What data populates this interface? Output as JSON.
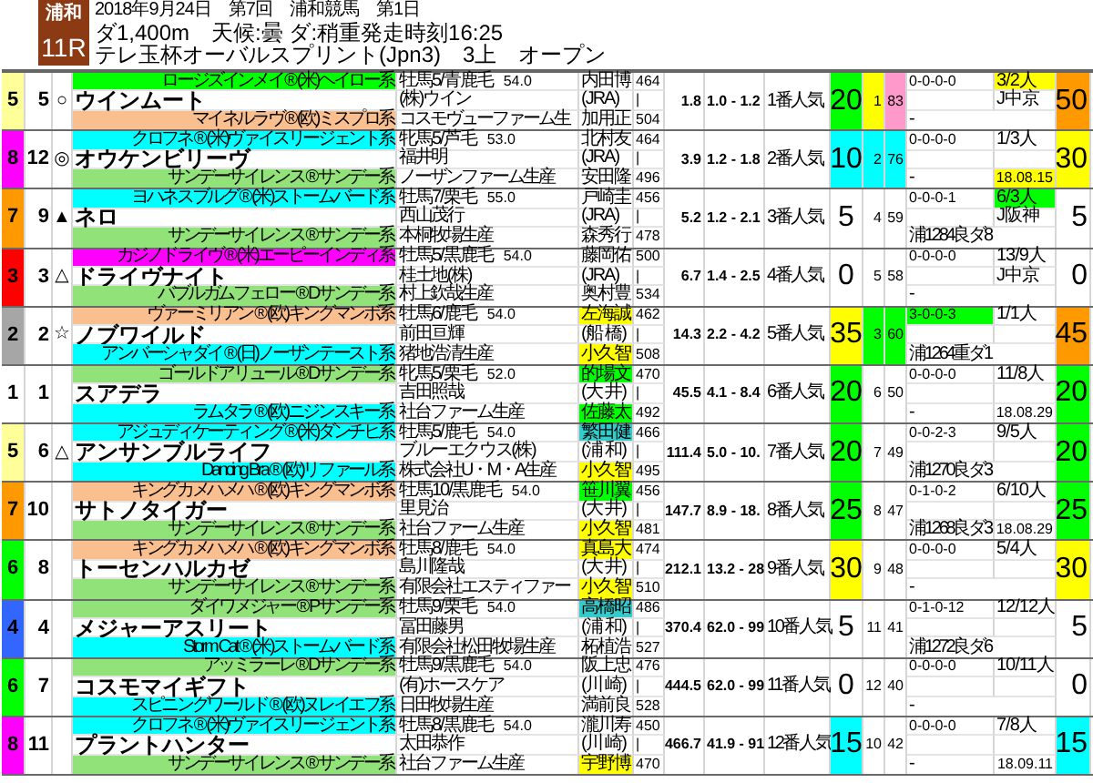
{
  "header": {
    "venue": "浦和",
    "race_no": "11R",
    "date_line": "2018年9月24日　第7回　浦和競馬　第1日",
    "course_line": "ダ1,400m　天候:曇 ダ:稍重発走時刻16:25",
    "race_title": "テレ玉杯オーバルスプリント(Jpn3)　3上　オープン"
  },
  "horses": [
    {
      "waku": {
        "text": "5",
        "color": "#ffff99"
      },
      "num": "5",
      "mark": "○",
      "sire_line": {
        "text": "ロージズインメイ ® (米)ヘイロー系",
        "color": "#00ff00"
      },
      "name": "ウインムート",
      "dam_line": {
        "text": "マイネルラヴ ® (欧)ミスプロ系",
        "color": "#fabf8f"
      },
      "sex_coat": "牡馬5/青鹿毛",
      "load": "54.0",
      "owner": "(株)ウイン",
      "breeder": "コスモヴューファーム生",
      "jockey": {
        "text": "内田博"
      },
      "affiliation": "(JRA)",
      "trainer": {
        "text": "加用正"
      },
      "body_weight": "464",
      "body_mid": "|",
      "body_weight_2": "504",
      "odds": "1.8",
      "odds_range": "1.0 - 1.2",
      "popularity": "1番人気",
      "score": {
        "text": "20",
        "color": "#00ff00"
      },
      "rank": {
        "text": "1",
        "color": "#ffff00"
      },
      "index": {
        "text": "83",
        "color": "#ff99cc"
      },
      "record": {
        "text": "0-0-0-0"
      },
      "record_note": "-",
      "past_rank": {
        "text": "3/2人",
        "color": "#ffff00"
      },
      "past_course": "J中京",
      "final": {
        "text": "50",
        "color": "#ff9900"
      }
    },
    {
      "waku": {
        "text": "8",
        "color": "#ff00ff"
      },
      "num": "12",
      "mark": "◎",
      "sire_line": {
        "text": "クロフネ ® (米)ヴァイスリージェント系",
        "color": "#00ffff"
      },
      "name": "オウケンビリーヴ",
      "dam_line": {
        "text": "サンデーサイレンス ® サンデー系",
        "color": "#92e27a"
      },
      "sex_coat": "牝馬5/芦毛",
      "load": "53.0",
      "owner": "福井明",
      "breeder": "ノーザンファーム生産",
      "jockey": {
        "text": "北村友"
      },
      "affiliation": "(JRA)",
      "trainer": {
        "text": "安田隆"
      },
      "body_weight": "464",
      "body_mid": "|",
      "body_weight_2": "496",
      "odds": "3.9",
      "odds_range": "1.2 - 1.8",
      "popularity": "2番人気",
      "score": {
        "text": "10",
        "color": "#00ffff"
      },
      "rank": {
        "text": "2",
        "color": "#00ffff"
      },
      "index": {
        "text": "76",
        "color": "#00ffff"
      },
      "record": {
        "text": "0-0-0-0"
      },
      "record_note": "-",
      "past_rank": {
        "text": "1/3人"
      },
      "past_date": {
        "text": "18.08.15",
        "color": "#ffff00"
      },
      "final": {
        "text": "30",
        "color": "#ffff00"
      }
    },
    {
      "waku": {
        "text": "7",
        "color": "#ff9900"
      },
      "num": "9",
      "mark": "▲",
      "sire_line": {
        "text": "ヨハネスブルグ ® (米)ストームバード系",
        "color": "#00ffff"
      },
      "name": "ネロ",
      "dam_line": {
        "text": "サンデーサイレンス ® サンデー系",
        "color": "#92e27a"
      },
      "sex_coat": "牡馬7/栗毛",
      "load": "55.0",
      "owner": "西山茂行",
      "breeder": "本桐牧場生産",
      "jockey": {
        "text": "戸崎圭"
      },
      "affiliation": "(JRA)",
      "trainer": {
        "text": "森秀行"
      },
      "body_weight": "456",
      "body_mid": "|",
      "body_weight_2": "478",
      "odds": "5.2",
      "odds_range": "1.2 - 2.1",
      "popularity": "3番人気",
      "score": {
        "text": "5"
      },
      "rank": {
        "text": "4"
      },
      "index": {
        "text": "59"
      },
      "record": {
        "text": "0-0-0-1"
      },
      "record_note": "浦1284良ダ8",
      "past_rank": {
        "text": "6/3人",
        "color": "#00ff00"
      },
      "past_course": "J阪神",
      "final": {
        "text": "5"
      }
    },
    {
      "waku": {
        "text": "3",
        "color": "#ff0000"
      },
      "num": "3",
      "mark": "△",
      "sire_line": {
        "text": "カジノドライヴ ® (米)エーピーインディ系",
        "color": "#ff00ff"
      },
      "name": "ドライヴナイト",
      "dam_line": {
        "text": "バブルガムフェロー ® Dサンデー系",
        "color": "#92e27a"
      },
      "sex_coat": "牡馬5/黒鹿毛",
      "load": "54.0",
      "owner": "桂土地(株)",
      "breeder": "村上欽哉生産",
      "jockey": {
        "text": "藤岡佑"
      },
      "affiliation": "(JRA)",
      "trainer": {
        "text": "奥村豊"
      },
      "body_weight": "500",
      "body_mid": "|",
      "body_weight_2": "534",
      "odds": "6.7",
      "odds_range": "1.4 - 2.5",
      "popularity": "4番人気",
      "score": {
        "text": "0"
      },
      "rank": {
        "text": "5"
      },
      "index": {
        "text": "58"
      },
      "record": {
        "text": "0-0-0-0"
      },
      "record_note": "-",
      "past_rank": {
        "text": "13/9人"
      },
      "past_course": "J中京",
      "final": {
        "text": "0"
      }
    },
    {
      "waku": {
        "text": "2",
        "color": "#a6a6a6"
      },
      "num": "2",
      "mark": "☆",
      "sire_line": {
        "text": "ヴァーミリアン ® (欧)キングマンボ系",
        "color": "#fabf8f"
      },
      "name": "ノブワイルド",
      "dam_line": {
        "text": "アンバーシャダイ ® (日)ノーザンテースト系",
        "color": "#00ffff"
      },
      "sex_coat": "牡馬6/鹿毛",
      "load": "54.0",
      "owner": "前田亘輝",
      "breeder": "猪地浩清生産",
      "jockey": {
        "text": "左海誠",
        "color": "#ffff00"
      },
      "affiliation": "(船 橋)",
      "trainer": {
        "text": "小久智",
        "color": "#ffff00"
      },
      "body_weight": "462",
      "body_mid": "|",
      "body_weight_2": "508",
      "odds": "14.3",
      "odds_range": "2.2 - 4.2",
      "popularity": "5番人気",
      "score": {
        "text": "35",
        "color": "#ffff00"
      },
      "rank": {
        "text": "3",
        "color": "#00ff00"
      },
      "index": {
        "text": "60",
        "color": "#00ff00"
      },
      "record": {
        "text": "3-0-0-3",
        "color": "#00ff00"
      },
      "record_note": "浦1264重ダ1",
      "past_rank": {
        "text": "1/1人"
      },
      "final": {
        "text": "45",
        "color": "#ff9900"
      }
    },
    {
      "waku": {
        "text": "1",
        "color": "#ffffff"
      },
      "num": "1",
      "sire_line": {
        "text": "ゴールドアリュール ® Dサンデー系",
        "color": "#92e27a"
      },
      "name": "スアデラ",
      "dam_line": {
        "text": "ラムタラ ® (欧)ニジンスキー系",
        "color": "#00ffff"
      },
      "sex_coat": "牝馬5/栗毛",
      "load": "52.0",
      "owner": "吉田照哉",
      "breeder": "社台ファーム生産",
      "jockey": {
        "text": "的場文",
        "color": "#00ff00"
      },
      "affiliation": "(大 井)",
      "trainer": {
        "text": "佐藤太",
        "color": "#00ff00"
      },
      "body_weight": "470",
      "body_mid": "|",
      "body_weight_2": "492",
      "odds": "45.5",
      "odds_range": "4.1 - 8.4",
      "popularity": "6番人気",
      "score": {
        "text": "20",
        "color": "#00ff00"
      },
      "rank": {
        "text": "6"
      },
      "index": {
        "text": "50"
      },
      "record": {
        "text": "0-0-0-0"
      },
      "record_note": "-",
      "past_rank": {
        "text": "11/8人"
      },
      "past_date": {
        "text": "18.08.29"
      },
      "final": {
        "text": "20",
        "color": "#00ff00"
      }
    },
    {
      "waku": {
        "text": "5",
        "color": "#ffff99"
      },
      "num": "6",
      "mark": "△",
      "sire_line": {
        "text": "アジュディケーティング ® (米)ダンチヒ系",
        "color": "#00ffff"
      },
      "name": "アンサンブルライフ",
      "dam_line": {
        "text": "Dancing Bra ® (欧)リファール系",
        "color": "#00ffff"
      },
      "sex_coat": "牡馬5/鹿毛",
      "load": "54.0",
      "owner": "ブルーエクウス(株)",
      "breeder": "株式会社U・M・A生産",
      "jockey": {
        "text": "繁田健",
        "color": "#33cccc"
      },
      "affiliation": "(浦 和)",
      "trainer": {
        "text": "小久智",
        "color": "#ffff00"
      },
      "body_weight": "466",
      "body_mid": "|",
      "body_weight_2": "495",
      "odds": "111.4",
      "odds_range": "5.0 - 10.",
      "popularity": "7番人気",
      "score": {
        "text": "20",
        "color": "#00ff00"
      },
      "rank": {
        "text": "7"
      },
      "index": {
        "text": "49"
      },
      "record": {
        "text": "0-0-2-3"
      },
      "record_note": "浦1270良ダ3",
      "past_rank": {
        "text": "9/5人"
      },
      "final": {
        "text": "20",
        "color": "#00ff00"
      }
    },
    {
      "waku": {
        "text": "7",
        "color": "#ff9900"
      },
      "num": "10",
      "sire_line": {
        "text": "キングカメハメハ ® (欧)キングマンボ系",
        "color": "#fabf8f"
      },
      "name": "サトノタイガー",
      "dam_line": {
        "text": "サンデーサイレンス ® サンデー系",
        "color": "#92e27a"
      },
      "sex_coat": "牡馬10/黒鹿毛",
      "load": "54.0",
      "owner": "里見治",
      "breeder": "社台ファーム生産",
      "jockey": {
        "text": "笹川翼",
        "color": "#00ff00"
      },
      "affiliation": "(大 井)",
      "trainer": {
        "text": "小久智",
        "color": "#ffff00"
      },
      "body_weight": "456",
      "body_mid": "|",
      "body_weight_2": "481",
      "odds": "147.7",
      "odds_range": "8.9 - 18.",
      "popularity": "8番人気",
      "score": {
        "text": "25",
        "color": "#00ff00"
      },
      "rank": {
        "text": "8"
      },
      "index": {
        "text": "47"
      },
      "record": {
        "text": "0-1-0-2"
      },
      "record_note": "浦1268良ダ3",
      "past_rank": {
        "text": "6/10人"
      },
      "past_date": {
        "text": "18.08.29"
      },
      "final": {
        "text": "25",
        "color": "#00ff00"
      }
    },
    {
      "waku": {
        "text": "6",
        "color": "#00ff00"
      },
      "num": "8",
      "sire_line": {
        "text": "キングカメハメハ ® (欧)キングマンボ系",
        "color": "#fabf8f"
      },
      "name": "トーセンハルカゼ",
      "dam_line": {
        "text": "サンデーサイレンス ® サンデー系",
        "color": "#92e27a"
      },
      "sex_coat": "牡馬8/鹿毛",
      "load": "54.0",
      "owner": "島川隆哉",
      "breeder": "有限会社エスティファー",
      "jockey": {
        "text": "真島大",
        "color": "#ffff00"
      },
      "affiliation": "(大 井)",
      "trainer": {
        "text": "小久智",
        "color": "#ffff00"
      },
      "body_weight": "474",
      "body_mid": "|",
      "body_weight_2": "510",
      "odds": "212.1",
      "odds_range": "13.2 - 28",
      "popularity": "9番人気",
      "score": {
        "text": "30",
        "color": "#ffff00"
      },
      "rank": {
        "text": "9"
      },
      "index": {
        "text": "48"
      },
      "record": {
        "text": "0-0-0-0"
      },
      "record_note": "-",
      "past_rank": {
        "text": "5/4人"
      },
      "final": {
        "text": "30",
        "color": "#ffff00"
      }
    },
    {
      "waku": {
        "text": "4",
        "color": "#3366ff"
      },
      "num": "4",
      "sire_line": {
        "text": "ダイワメジャー ® Pサンデー系",
        "color": "#92e27a"
      },
      "name": "メジャーアスリート",
      "dam_line": {
        "text": "Storm Cat ® (米)ストームバード系",
        "color": "#00ffff"
      },
      "sex_coat": "牡馬9/栗毛",
      "load": "54.0",
      "owner": "冨田藤男",
      "breeder": "有限会社松田牧場生産",
      "jockey": {
        "text": "高橋昭",
        "color": "#33cccc"
      },
      "affiliation": "(浦 和)",
      "trainer": {
        "text": "柘植浩"
      },
      "body_weight": "486",
      "body_mid": "|",
      "body_weight_2": "527",
      "odds": "370.4",
      "odds_range": "62.0 - 99",
      "popularity": "10番人気",
      "score": {
        "text": "5"
      },
      "rank": {
        "text": "11"
      },
      "index": {
        "text": "41"
      },
      "record": {
        "text": "0-1-0-12"
      },
      "record_note": "浦1272良ダ6",
      "past_rank": {
        "text": "12/12人"
      },
      "final": {
        "text": "5"
      }
    },
    {
      "waku": {
        "text": "6",
        "color": "#00ff00"
      },
      "num": "7",
      "sire_line": {
        "text": "アッミラーレ ® Dサンデー系",
        "color": "#92e27a"
      },
      "name": "コスモマイギフト",
      "dam_line": {
        "text": "スピニングワールド ® (欧)ヌレイエフ系",
        "color": "#00ffff"
      },
      "sex_coat": "牡馬9/黒鹿毛",
      "load": "54.0",
      "owner": "(有)ホースケア",
      "breeder": "日田牧場生産",
      "jockey": {
        "text": "阪上忠"
      },
      "affiliation": "(川 崎)",
      "trainer": {
        "text": "満前良"
      },
      "body_weight": "476",
      "body_mid": "|",
      "body_weight_2": "528",
      "odds": "444.5",
      "odds_range": "62.0 - 99",
      "popularity": "11番人気",
      "score": {
        "text": "0"
      },
      "rank": {
        "text": "12"
      },
      "index": {
        "text": "40"
      },
      "record": {
        "text": "0-0-0-0"
      },
      "record_note": "-",
      "past_rank": {
        "text": "10/11人"
      },
      "final": {
        "text": "0"
      }
    },
    {
      "waku": {
        "text": "8",
        "color": "#ff00ff"
      },
      "num": "11",
      "sire_line": {
        "text": "クロフネ ® (米)ヴァイスリージェント系",
        "color": "#00ffff"
      },
      "name": "プラントハンター",
      "dam_line": {
        "text": "サンデーサイレンス ® サンデー系",
        "color": "#92e27a"
      },
      "sex_coat": "牡馬8/黒鹿毛",
      "load": "54.0",
      "owner": "太田恭作",
      "breeder": "社台ファーム生産",
      "jockey": {
        "text": "瀧川寿"
      },
      "affiliation": "(川 崎)",
      "trainer": {
        "text": "宇野博",
        "color": "#ffff00"
      },
      "body_weight": "450",
      "body_mid": "|",
      "body_weight_2": "470",
      "odds": "466.7",
      "odds_range": "41.9 - 91",
      "popularity": "12番人気",
      "score": {
        "text": "15",
        "color": "#00ffff"
      },
      "rank": {
        "text": "10"
      },
      "index": {
        "text": "42"
      },
      "record": {
        "text": "0-0-0-0"
      },
      "record_note": "-",
      "past_rank": {
        "text": "7/8人"
      },
      "past_date": {
        "text": "18.09.11"
      },
      "final": {
        "text": "15",
        "color": "#00ffff"
      }
    }
  ]
}
